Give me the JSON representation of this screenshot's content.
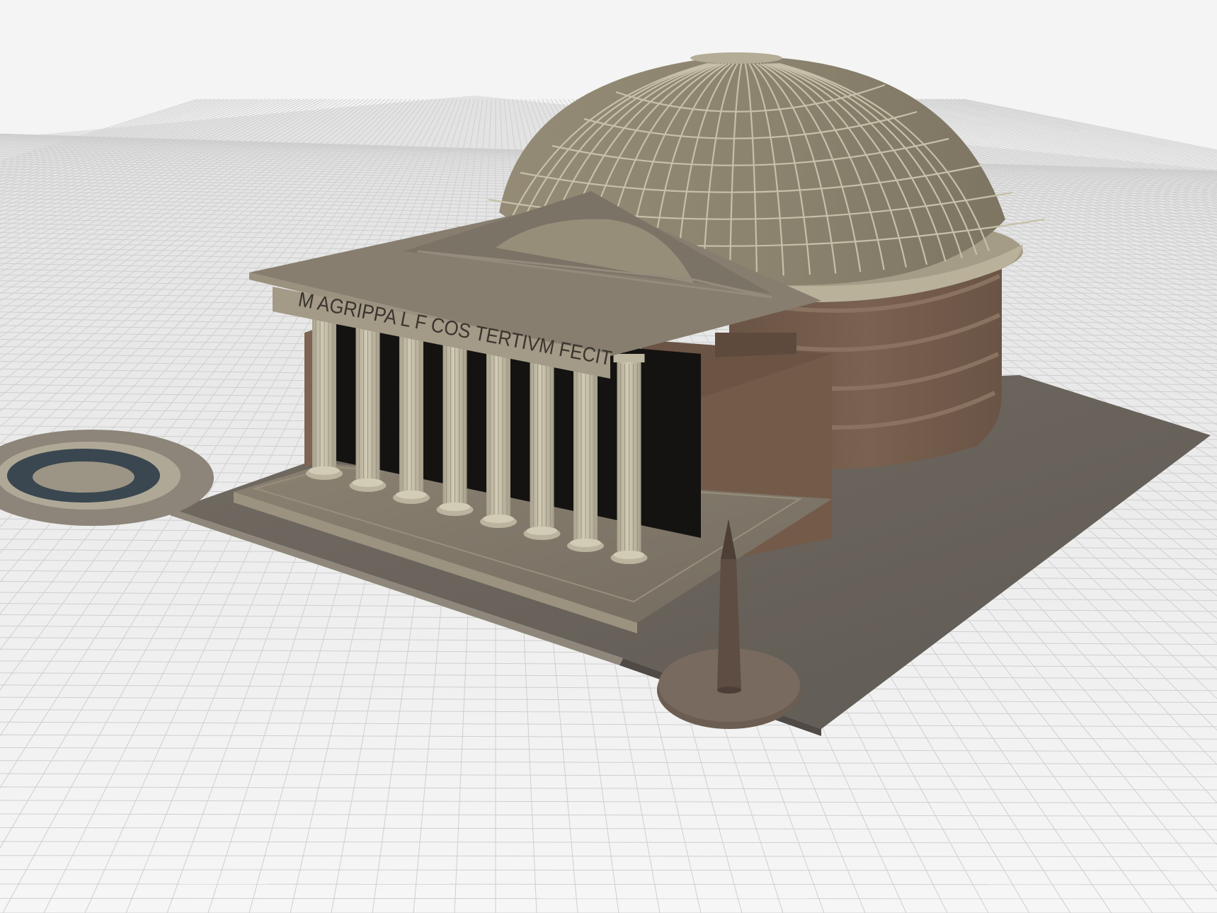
{
  "viewport": {
    "background": "#f4f4f4",
    "grid_color": "#d6d6d6",
    "grid_line": "#c8c8c8"
  },
  "model": {
    "inscription": "M AGRIPPA L F COS TERTIVM FECIT",
    "columns_visible": 8,
    "colors": {
      "dome": "#8e8672",
      "dome_rib": "#c7c0a9",
      "drum": "#6f5849",
      "plaza": "#6e675e",
      "portico_roof": "#837a6d",
      "column": "#c9c3ad",
      "interior": "#141311",
      "obelisk": "#5e4d42",
      "fountain_water": "#3a4750"
    },
    "parts": [
      "dome",
      "drum",
      "portico",
      "pediment",
      "columns",
      "plaza",
      "fountain",
      "obelisk"
    ]
  }
}
